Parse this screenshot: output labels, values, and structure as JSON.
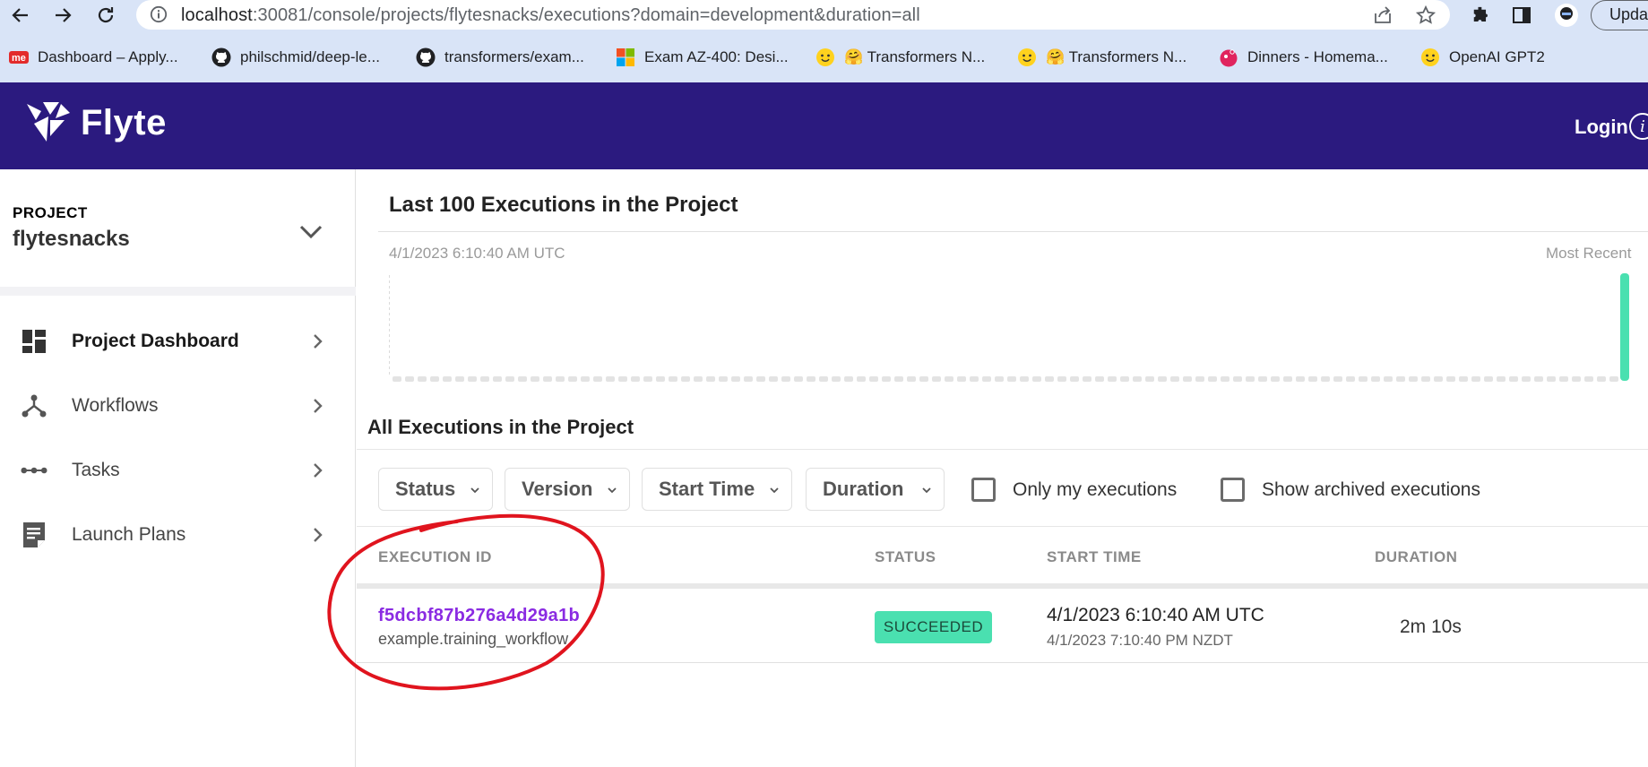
{
  "browser": {
    "url_host": "localhost",
    "url_path": ":30081/console/projects/flytesnacks/executions?domain=development&duration=all",
    "update_label": "Upda",
    "bookmarks": [
      {
        "label": "Dashboard – Apply...",
        "icon": "me-favicon"
      },
      {
        "label": "philschmid/deep-le...",
        "icon": "github-icon"
      },
      {
        "label": "transformers/exam...",
        "icon": "github-icon"
      },
      {
        "label": "Exam AZ-400: Desi...",
        "icon": "microsoft-icon"
      },
      {
        "label": "🤗 Transformers N...",
        "icon": "huggingface-icon"
      },
      {
        "label": "🤗 Transformers N...",
        "icon": "huggingface-icon"
      },
      {
        "label": "Dinners - Homema...",
        "icon": "dinners-icon"
      },
      {
        "label": "OpenAI GPT2",
        "icon": "huggingface-icon"
      }
    ]
  },
  "header": {
    "logo_text": "Flyte",
    "login_label": "Login",
    "info_glyph": "i",
    "background_color": "#2b1a7f"
  },
  "sidebar": {
    "project_label": "PROJECT",
    "project_name": "flytesnacks",
    "items": [
      {
        "label": "Project Dashboard",
        "icon": "dashboard-icon",
        "active": true
      },
      {
        "label": "Workflows",
        "icon": "workflow-icon",
        "active": false
      },
      {
        "label": "Tasks",
        "icon": "tasks-icon",
        "active": false
      },
      {
        "label": "Launch Plans",
        "icon": "launch-plan-icon",
        "active": false
      }
    ]
  },
  "main": {
    "chart_title": "Last 100 Executions in the Project",
    "chart_start_label": "4/1/2023 6:10:40 AM UTC",
    "chart_end_label": "Most Recent",
    "section_title": "All Executions in the Project",
    "filters": [
      "Status",
      "Version",
      "Start Time",
      "Duration"
    ],
    "checkboxes": [
      "Only my executions",
      "Show archived executions"
    ],
    "columns": [
      "EXECUTION ID",
      "STATUS",
      "START TIME",
      "DURATION"
    ],
    "rows": [
      {
        "execution_id": "f5dcbf87b276a4d29a1b",
        "workflow": "example.training_workflow",
        "status": "SUCCEEDED",
        "start_utc": "4/1/2023 6:10:40 AM UTC",
        "start_local": "4/1/2023 7:10:40 PM NZDT",
        "duration": "2m 10s"
      }
    ],
    "status_color": "#4ae0b0",
    "annotation_color": "#e0141e"
  }
}
